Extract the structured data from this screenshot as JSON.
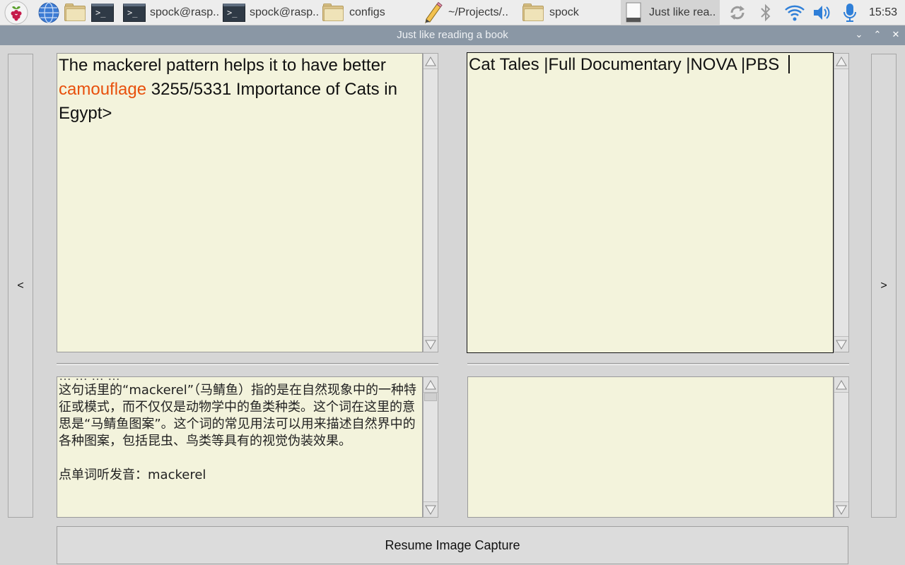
{
  "taskbar": {
    "items": [
      {
        "icon": "raspberry-pi-menu-icon"
      },
      {
        "icon": "globe-browser-icon"
      },
      {
        "icon": "folder-icon"
      },
      {
        "icon": "terminal-icon"
      },
      {
        "icon": "terminal-icon",
        "label": "spock@rasp.."
      },
      {
        "icon": "terminal-icon",
        "label": "spock@rasp.."
      },
      {
        "icon": "folder-icon",
        "label": "configs"
      },
      {
        "icon": "pencil-editor-icon",
        "label": "~/Projects/.."
      },
      {
        "icon": "folder-icon",
        "label": "spock"
      },
      {
        "icon": "document-icon",
        "label": "Just like rea.."
      }
    ],
    "tray": {
      "icons": [
        "sync-icon",
        "bluetooth-icon",
        "wifi-icon",
        "volume-icon",
        "microphone-icon"
      ],
      "clock": "15:53"
    },
    "terminal_glyph": ">_"
  },
  "window": {
    "title": "Just like reading a book",
    "minimize_glyph": "⌄",
    "maximize_glyph": "⌃",
    "close_glyph": "✕"
  },
  "app": {
    "prev_label": "<",
    "next_label": ">",
    "top_left": {
      "before_highlight": "The mackerel pattern helps it to have better ",
      "highlight": "camouflage",
      "after_highlight": " 3255/5331 Importance of Cats in Egypt>"
    },
    "top_right": {
      "text": "Cat Tales |Full Documentary |NOVA |PBS "
    },
    "bottom_left": {
      "cut_line": "…  …  …  …",
      "explanation": "这句话里的“mackerel”（马鲭鱼）指的是在自然现象中的一种特征或模式，而不仅仅是动物学中的鱼类种类。这个词在这里的意思是“马鲭鱼图案”。这个词的常见用法可以用来描述自然界中的各种图案，包括昆虫、鸟类等具有的视觉伪装效果。",
      "pronounce_label": "点单词听发音：mackerel"
    },
    "bottom_right": {
      "text": ""
    },
    "resume_button": "Resume Image Capture"
  }
}
